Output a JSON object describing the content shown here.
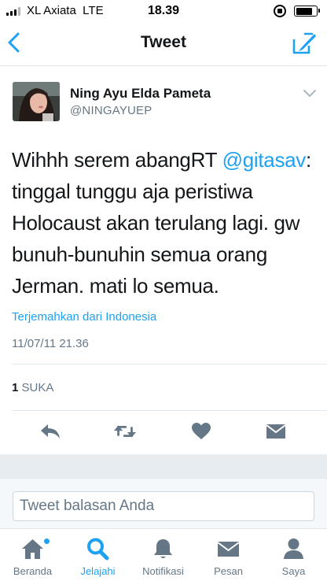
{
  "status_bar": {
    "carrier": "XL Axiata",
    "network": "LTE",
    "time": "18.39",
    "signal_bars": 4,
    "signal_active": 3,
    "battery_level": 0.8
  },
  "nav": {
    "title": "Tweet",
    "back_icon": "chevron-left-icon",
    "compose_icon": "compose-tweet-icon"
  },
  "tweet": {
    "author_name": "Ning Ayu Elda Pameta",
    "author_handle": "@NINGAYUEP",
    "text_before": "Wihhh serem abangRT ",
    "mention": "@gitasav",
    "text_after": ": tinggal tunggu aja peristiwa Holocaust akan terulang lagi. gw bunuh-bunuhin semua orang Jerman. mati lo semua.",
    "translate_label": "Terjemahkan dari Indonesia",
    "timestamp": "11/07/11 21.36",
    "like_count": "1",
    "like_label": "SUKA"
  },
  "actions": [
    {
      "name": "reply-icon"
    },
    {
      "name": "retweet-icon"
    },
    {
      "name": "heart-icon"
    },
    {
      "name": "direct-message-icon"
    }
  ],
  "reply": {
    "placeholder": "Tweet balasan Anda"
  },
  "tabs": [
    {
      "id": "home",
      "label": "Beranda",
      "icon": "home-icon",
      "active": false,
      "badge": true
    },
    {
      "id": "explore",
      "label": "Jelajahi",
      "icon": "search-icon",
      "active": true,
      "badge": false
    },
    {
      "id": "notifications",
      "label": "Notifikasi",
      "icon": "bell-icon",
      "active": false,
      "badge": false
    },
    {
      "id": "messages",
      "label": "Pesan",
      "icon": "envelope-icon",
      "active": false,
      "badge": false
    },
    {
      "id": "me",
      "label": "Saya",
      "icon": "person-icon",
      "active": false,
      "badge": false
    }
  ],
  "colors": {
    "accent": "#1da1f2",
    "text": "#14171a",
    "muted": "#657786",
    "icon_gray": "#657786",
    "divider": "#e1e8ed"
  }
}
